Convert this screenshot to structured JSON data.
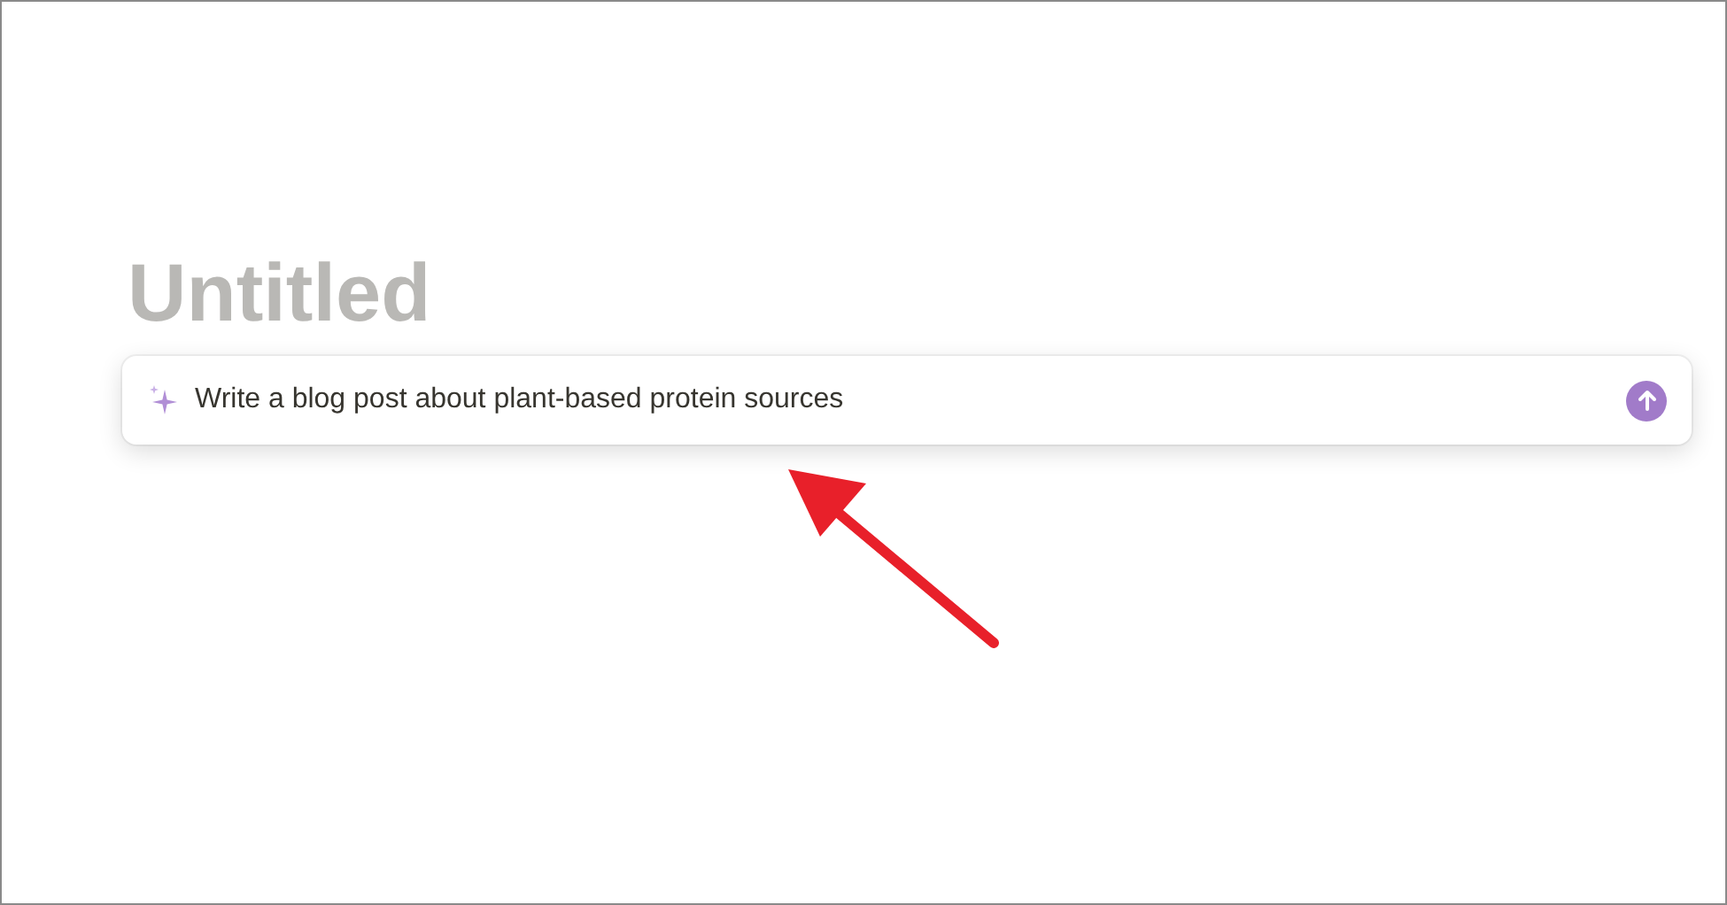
{
  "page": {
    "title": "Untitled"
  },
  "prompt": {
    "value": "Write a blog post about plant-based protein sources"
  }
}
